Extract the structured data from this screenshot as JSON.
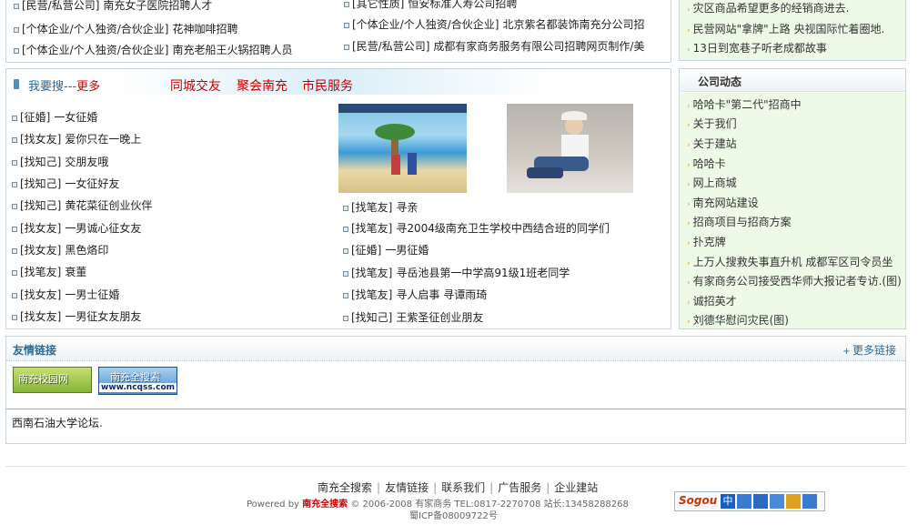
{
  "top_list": {
    "left": [
      {
        "tag": "[民营/私营公司]",
        "text": "南充女子医院招聘人才"
      },
      {
        "tag": "[个体企业/个人独资/合伙企业]",
        "text": "花神咖啡招聘"
      },
      {
        "tag": "[个体企业/个人独资/合伙企业]",
        "text": "南充老船王火锅招聘人员"
      }
    ],
    "right": [
      {
        "tag": "[其它性质]",
        "text": "恒安标准人寿公司招聘"
      },
      {
        "tag": "[个体企业/个人独资/合伙企业]",
        "text": "北京紫名都装饰南充分公司招"
      },
      {
        "tag": "[民营/私营公司]",
        "text": "成都有家商务服务有限公司招聘网页制作/美"
      }
    ]
  },
  "top_right_news": [
    "灾区商品希望更多的经销商进去.",
    "民营网站\"拿牌\"上路 央视国际忙着圈地.",
    "13日到宽巷子听老成都故事"
  ],
  "search_section": {
    "title": "我要搜",
    "more_sep": "---",
    "more": "更多",
    "tabs": [
      "同城交友",
      "聚会南充",
      "市民服务"
    ],
    "left_items": [
      {
        "tag": "[征婚]",
        "text": "一女征婚"
      },
      {
        "tag": "[找女友]",
        "text": "爱你只在一晚上"
      },
      {
        "tag": "[找知己]",
        "text": "交朋友哦"
      },
      {
        "tag": "[找知己]",
        "text": "一女征好友"
      },
      {
        "tag": "[找知己]",
        "text": "黄花菜征创业伙伴"
      },
      {
        "tag": "[找女友]",
        "text": "一男诚心征女友"
      },
      {
        "tag": "[找女友]",
        "text": "黑色烙印"
      },
      {
        "tag": "[找笔友]",
        "text": "衰董"
      },
      {
        "tag": "[找女友]",
        "text": "一男士征婚"
      },
      {
        "tag": "[找女友]",
        "text": "一男征女友朋友"
      }
    ],
    "right_items": [
      {
        "tag": "[找笔友]",
        "text": "寻亲"
      },
      {
        "tag": "[找笔友]",
        "text": "寻2004级南充卫生学校中西结合班的同学们"
      },
      {
        "tag": "[征婚]",
        "text": "一男征婚"
      },
      {
        "tag": "[找笔友]",
        "text": "寻岳池县第一中学高91级1班老同学"
      },
      {
        "tag": "[找笔友]",
        "text": "寻人启事 寻谭雨琦"
      },
      {
        "tag": "[找知己]",
        "text": "王紫圣征创业朋友"
      }
    ]
  },
  "company_news": {
    "title": "公司动态",
    "items": [
      "哈哈卡\"第二代\"招商中",
      "关于我们",
      "关于建站",
      "哈哈卡",
      "网上商城",
      "南充网站建设",
      "招商项目与招商方案",
      "扑克牌",
      "上万人搜救失事直升机 成都军区司令员坐",
      "有家商务公司接受西华师大报记者专访.(图)",
      "诚招英才",
      "刘德华慰问灾民(图)"
    ]
  },
  "friend_links": {
    "title": "友情链接",
    "more": "更多链接",
    "banner1": "南充校园网",
    "banner2_top": "南充全搜索",
    "banner2_bottom": "www.ncqss.com",
    "text_link": "西南石油大学论坛."
  },
  "footer": {
    "links": [
      "南充全搜索",
      "友情链接",
      "联系我们",
      "广告服务",
      "企业建站"
    ],
    "powered_prefix": "Powered by",
    "powered_brand": "南充全搜索",
    "powered_rest": "© 2006-2008 有家商务 TEL:0817-2270708 站长:13458288268",
    "icp": "蜀ICP备08009722号",
    "sogou_logo": "Sogou",
    "sogou_cn": "中"
  },
  "colors": {
    "accent_red": "#cc0000",
    "title_blue": "#2a6a9a",
    "right_panel_bg": "#eefae8",
    "border": "#c8d6dc"
  }
}
